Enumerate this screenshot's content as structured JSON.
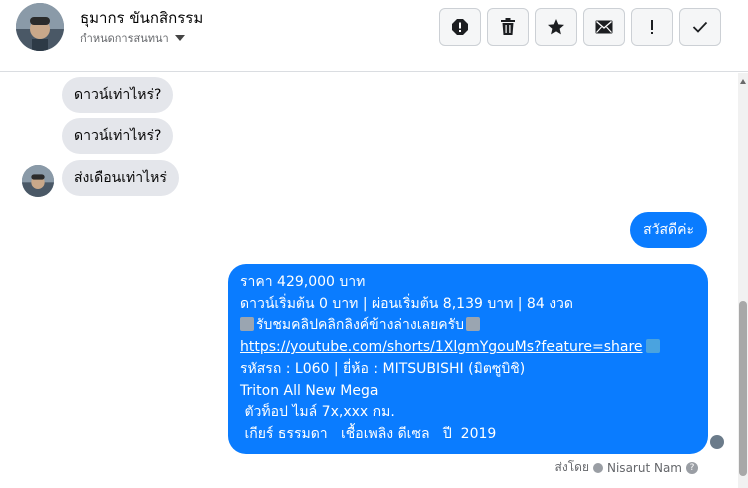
{
  "header": {
    "contact_name": "ธุมากร ขันกสิกรรม",
    "conversation_label": "กำหนดการสนทนา",
    "actions": [
      {
        "icon": "alert-icon"
      },
      {
        "icon": "trash-icon"
      },
      {
        "icon": "star-icon"
      },
      {
        "icon": "mail-icon"
      },
      {
        "icon": "exclamation-icon"
      },
      {
        "icon": "check-icon"
      }
    ]
  },
  "messages": {
    "incoming": [
      {
        "text": "ดาวน์เท่าไหร่?"
      },
      {
        "text": "ดาวน์เท่าไหร่?"
      },
      {
        "text": "ส่งเดือนเท่าไหร่"
      }
    ],
    "outgoing_greeting": "สวัสดีค่ะ",
    "outgoing_listing": {
      "line1": "ราคา 429,000 บาท",
      "line2": "ดาวน์เริ่มต้น 0 บาท | ผ่อนเริ่มต้น 8,139 บาท | 84 งวด",
      "line3": "รับชมคลิปคลิกลิงค์ข้างล่างเลยครับ",
      "link": "https://youtube.com/shorts/1XlgmYgouMs?feature=share",
      "line5": "รหัสรถ : L060 |  ยี่ห้อ : MITSUBISHI (มิตซูบิชิ)",
      "line6": "Triton All New Mega",
      "line7": " ตัวท็อป ไมล์ 7x,xxx กม.",
      "line8": " เกียร์ ธรรมดา   เชื้อเพลิง ดีเซล   ปี  2019"
    },
    "sent_by_label": "ส่งโดย",
    "sent_by_name": "Nisarut Nam"
  },
  "colors": {
    "outgoing_bubble": "#0a7cff",
    "incoming_bubble": "#e4e6eb"
  }
}
